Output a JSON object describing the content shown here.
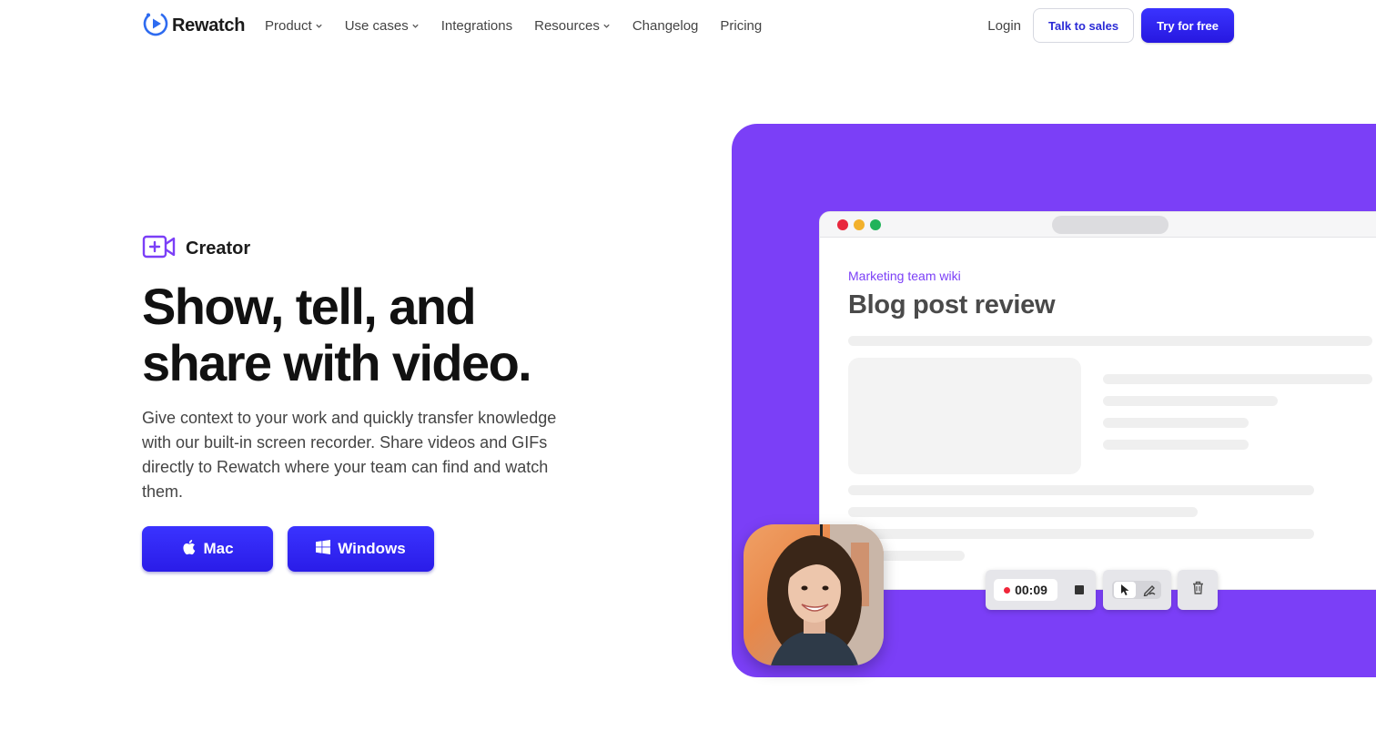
{
  "nav": {
    "logo_text": "Rewatch",
    "links": [
      {
        "label": "Product",
        "dropdown": true
      },
      {
        "label": "Use cases",
        "dropdown": true
      },
      {
        "label": "Integrations",
        "dropdown": false
      },
      {
        "label": "Resources",
        "dropdown": true
      },
      {
        "label": "Changelog",
        "dropdown": false
      },
      {
        "label": "Pricing",
        "dropdown": false
      }
    ],
    "login": "Login",
    "talk_to_sales": "Talk to sales",
    "try_for_free": "Try for free"
  },
  "hero": {
    "badge": "Creator",
    "headline_line1": "Show, tell, and",
    "headline_line2": "share with video.",
    "subtext": "Give context to your work and quickly transfer knowledge with our built-in screen recorder. Share videos and GIFs directly to Rewatch where your team can find and watch them.",
    "mac_button": "Mac",
    "windows_button": "Windows"
  },
  "mockup": {
    "wiki_label": "Marketing team wiki",
    "doc_title": "Blog post review",
    "timer": "00:09"
  },
  "colors": {
    "brand_blue": "#2f26f0",
    "panel_purple": "#7b3ff7",
    "record_red": "#f0263a"
  },
  "icons": [
    "rewatch-logo-icon",
    "chevron-down-icon",
    "video-plus-icon",
    "apple-icon",
    "windows-icon",
    "stop-icon",
    "pointer-icon",
    "draw-icon",
    "trash-icon"
  ]
}
